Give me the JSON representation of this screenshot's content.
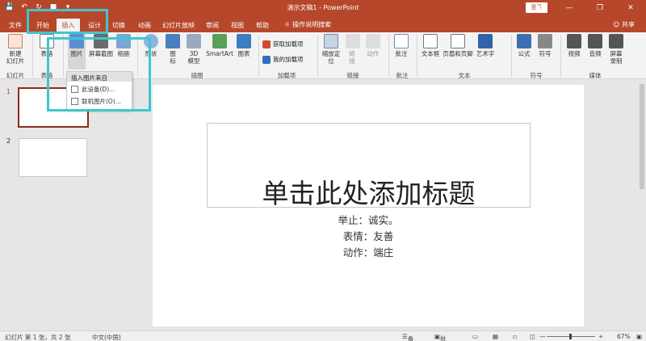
{
  "window": {
    "title": "演示文稿1  -  PowerPoint",
    "login": "登录"
  },
  "tabs": [
    "文件",
    "开始",
    "插入",
    "设计",
    "切换",
    "动画",
    "幻灯片放映",
    "审阅",
    "视图",
    "帮助"
  ],
  "active_tab": "插入",
  "search_hint": "操作说明搜索",
  "share": "共享",
  "ribbon": {
    "new_slide": "新建\n幻灯片",
    "table": "表格",
    "picture": "图片",
    "screenshot": "屏幕截图",
    "album": "相册",
    "shapes": "形状",
    "icons": "图\n标",
    "model3d": "3D\n模型",
    "smartart": "SmartArt",
    "chart": "图表",
    "get_addins": "获取加载项",
    "my_addins": "我的加载项",
    "zoom": "缩放定\n位",
    "link": "链\n接",
    "action": "动作",
    "comment": "批注",
    "textbox": "文本框",
    "header_footer": "页眉和页脚",
    "wordart": "艺术字",
    "equation": "公式",
    "symbol": "符号",
    "video": "视频",
    "audio": "音频",
    "screen_record": "屏幕\n录制",
    "groups": {
      "slides": "幻灯片",
      "tables": "表格",
      "images": "图像",
      "illustrations": "插图",
      "addins": "加载项",
      "links": "链接",
      "comments": "批注",
      "text": "文本",
      "symbols": "符号",
      "media": "媒体"
    }
  },
  "dropdown": {
    "header": "插入图片来自",
    "items": [
      "此设备(D)...",
      "联机图片(O)..."
    ]
  },
  "slides_panel": {
    "numbers": [
      "1",
      "2"
    ]
  },
  "slide": {
    "title": "单击此处添加标题",
    "lines": [
      "举止：诚实。",
      "表情：友善",
      "动作：端庄"
    ]
  },
  "status": {
    "slide_info": "幻灯片 第 1 张，共 2 张",
    "language": "中文(中国)",
    "notes": "备注",
    "comments": "批注",
    "zoom": "67%"
  },
  "colors": {
    "accent": "#b7472a",
    "highlight": "#3ec6cf"
  }
}
